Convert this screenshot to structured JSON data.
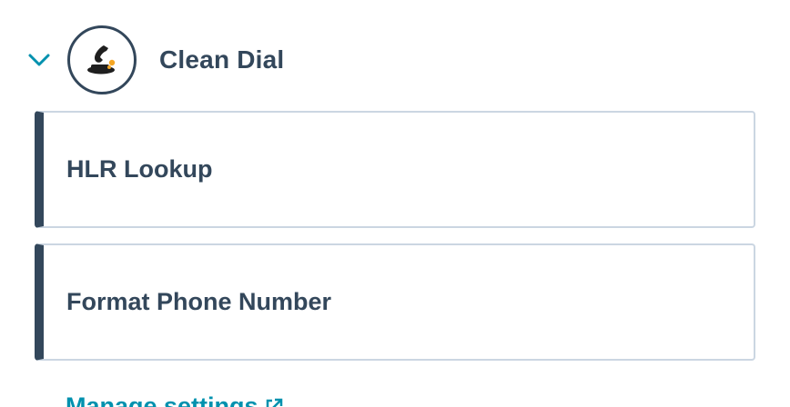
{
  "group": {
    "app_name": "Clean Dial",
    "logo_icon": "phone-handset-icon",
    "expanded": true,
    "chevron_icon": "chevron-down-icon"
  },
  "actions": [
    {
      "label": "HLR Lookup"
    },
    {
      "label": "Format Phone Number"
    }
  ],
  "footer": {
    "link_text": "Manage settings",
    "link_icon": "external-link-icon"
  },
  "colors": {
    "text": "#33475b",
    "border": "#cbd6e2",
    "accent_link": "#0091ae",
    "chevron": "#0091ae",
    "logo_accent": "#f5a623"
  }
}
